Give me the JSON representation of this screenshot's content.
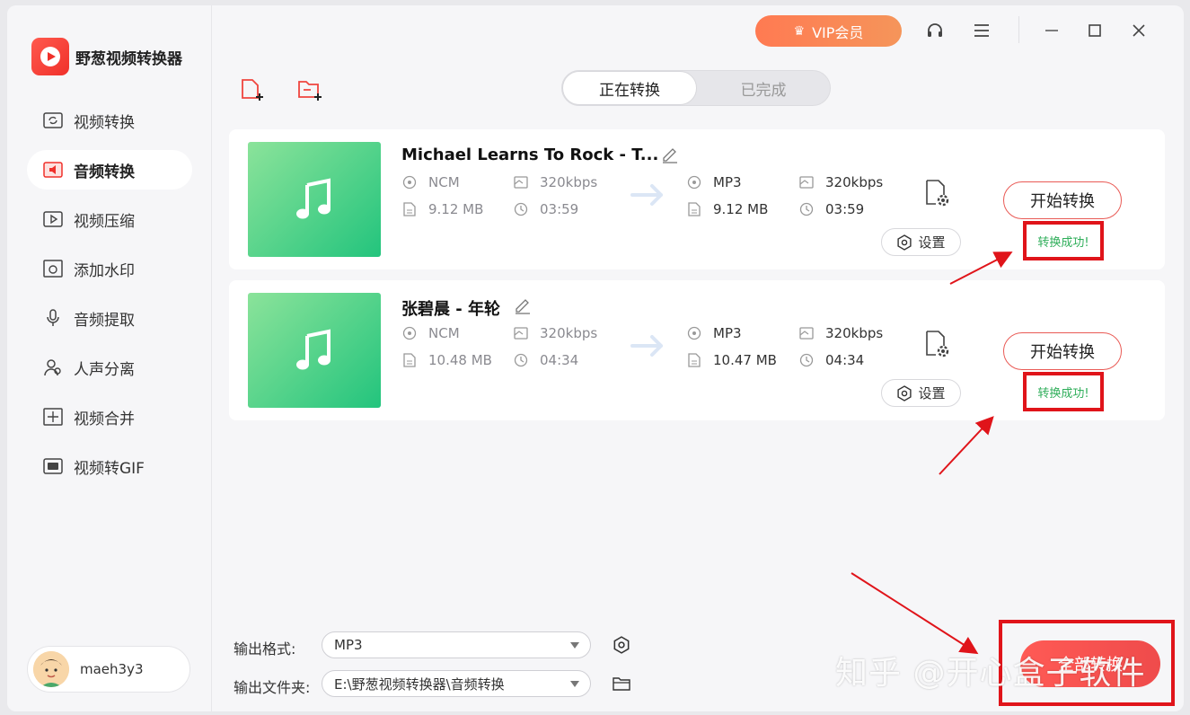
{
  "app": {
    "title": "野葱视频转换器"
  },
  "titlebar": {
    "vip_label": "VIP会员"
  },
  "sidebar": {
    "items": [
      {
        "label": "视频转换",
        "icon": "video-convert-icon"
      },
      {
        "label": "音频转换",
        "icon": "audio-convert-icon",
        "active": true
      },
      {
        "label": "视频压缩",
        "icon": "video-compress-icon"
      },
      {
        "label": "添加水印",
        "icon": "watermark-icon"
      },
      {
        "label": "音频提取",
        "icon": "audio-extract-icon"
      },
      {
        "label": "人声分离",
        "icon": "voice-separate-icon"
      },
      {
        "label": "视频合并",
        "icon": "video-merge-icon"
      },
      {
        "label": "视频转GIF",
        "icon": "gif-icon"
      }
    ],
    "user": {
      "name": "maeh3y3"
    }
  },
  "tabs": [
    {
      "label": "正在转换",
      "active": true
    },
    {
      "label": "已完成",
      "active": false
    }
  ],
  "files": [
    {
      "name": "Michael Learns To Rock - T...",
      "source": {
        "format": "NCM",
        "bitrate": "320kbps",
        "size": "9.12 MB",
        "duration": "03:59"
      },
      "target": {
        "format": "MP3",
        "bitrate": "320kbps",
        "size": "9.12 MB",
        "duration": "03:59"
      },
      "settings_label": "设置",
      "start_label": "开始转换",
      "status": "转换成功!"
    },
    {
      "name": "张碧晨 - 年轮",
      "source": {
        "format": "NCM",
        "bitrate": "320kbps",
        "size": "10.48 MB",
        "duration": "04:34"
      },
      "target": {
        "format": "MP3",
        "bitrate": "320kbps",
        "size": "10.47 MB",
        "duration": "04:34"
      },
      "settings_label": "设置",
      "start_label": "开始转换",
      "status": "转换成功!"
    }
  ],
  "bottom": {
    "format_label": "输出格式:",
    "format_value": "MP3",
    "folder_label": "输出文件夹:",
    "folder_value": "E:\\野葱视频转换器\\音频转换",
    "convert_all_label": "全部转换"
  },
  "watermark": "知乎 @开心盒子软件",
  "colors": {
    "accent": "#f0302a",
    "vip": "#ff7a52",
    "success": "#2fae5a",
    "annotation": "#e0141a"
  }
}
